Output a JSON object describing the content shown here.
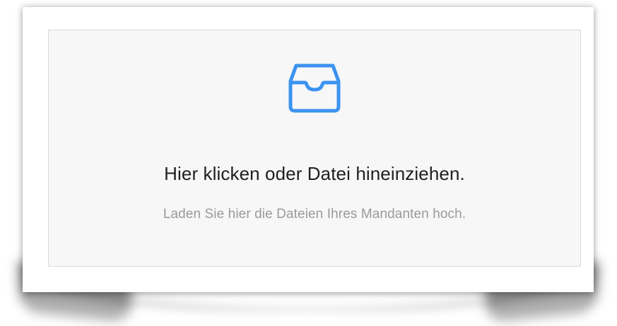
{
  "upload": {
    "title": "Hier klicken oder Datei hineinziehen.",
    "hint": "Laden Sie hier die Dateien Ihres Mandanten hoch.",
    "icon": "inbox-icon",
    "accent_color": "#3b93f0"
  }
}
